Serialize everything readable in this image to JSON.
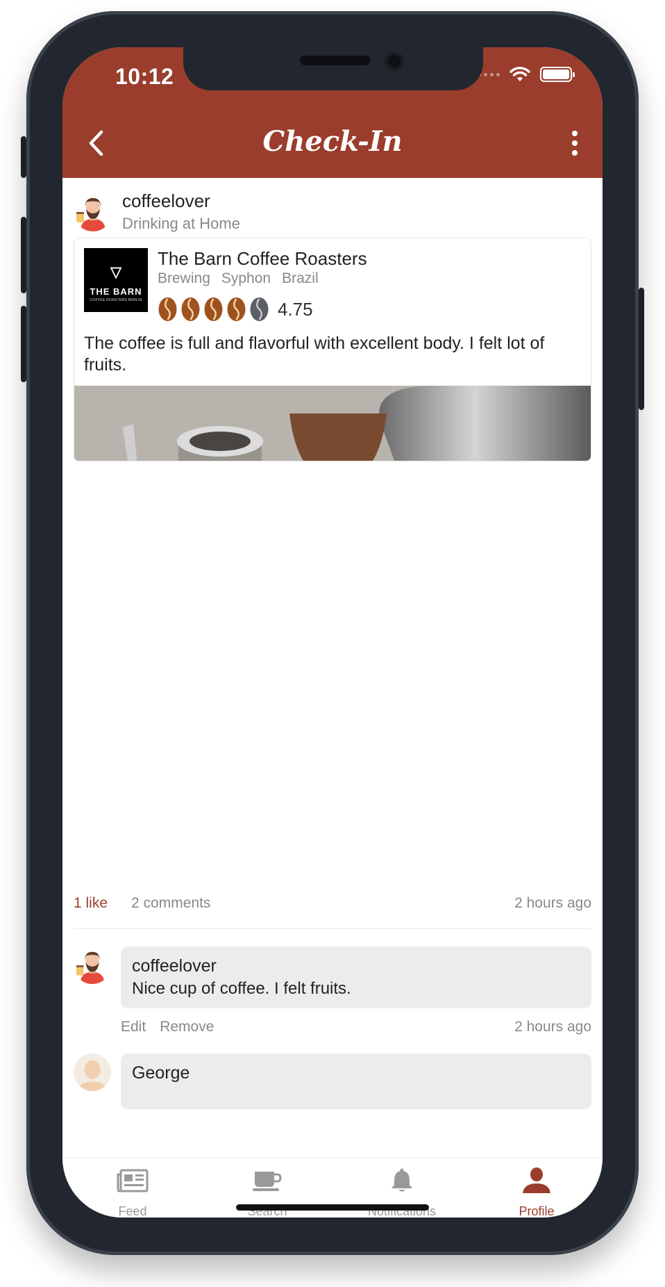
{
  "status_bar": {
    "time": "10:12"
  },
  "navbar": {
    "title": "Check-In"
  },
  "checkin": {
    "username": "coffeelover",
    "location": "Drinking at Home",
    "roaster": {
      "logo_text": "THE BARN",
      "logo_subtext": "COFFEE ROASTERS BERLIN",
      "name": "The Barn Coffee Roasters",
      "tags": [
        "Brewing",
        "Syphon",
        "Brazil"
      ]
    },
    "rating": {
      "value": "4.75",
      "max": 5,
      "score": 4.75
    },
    "review": "The coffee is full and flavorful with excellent body. I felt lot of fruits.",
    "likes": "1 like",
    "comments_count": "2 comments",
    "posted": "2 hours ago"
  },
  "comments": [
    {
      "name": "coffeelover",
      "text": "Nice cup of coffee. I felt fruits.",
      "edit": "Edit",
      "remove": "Remove",
      "time": "2 hours ago"
    },
    {
      "name": "George"
    }
  ],
  "tabs": [
    {
      "label": "Feed",
      "icon": "newspaper-icon"
    },
    {
      "label": "Search",
      "icon": "coffee-cup-icon"
    },
    {
      "label": "Notifications",
      "icon": "bell-icon"
    },
    {
      "label": "Profile",
      "icon": "person-icon",
      "active": true
    }
  ],
  "colors": {
    "brand": "#9a3d2c",
    "muted": "#888888",
    "bubble": "#ececec"
  }
}
